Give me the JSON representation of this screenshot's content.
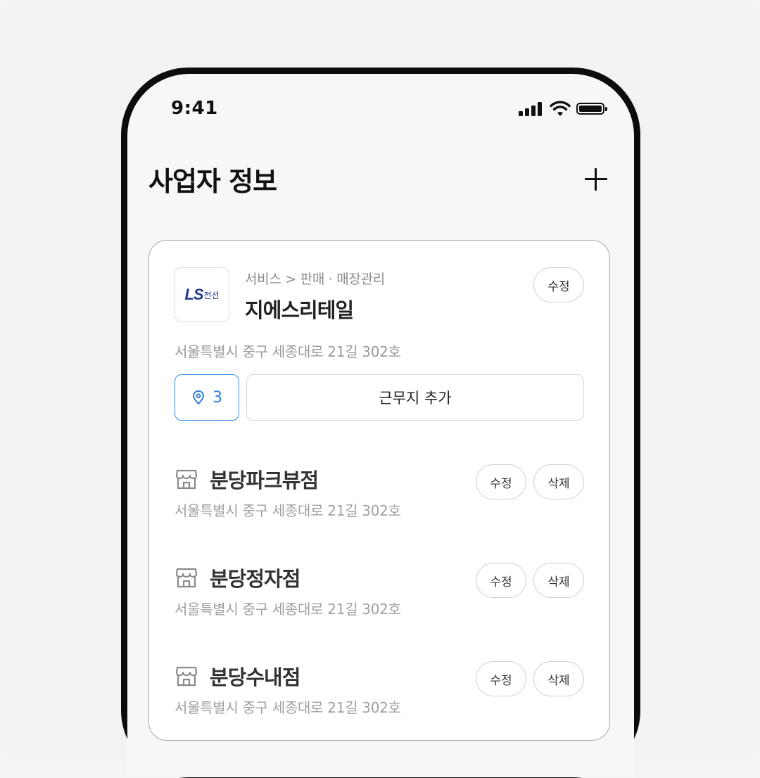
{
  "status_bar": {
    "time": "9:41"
  },
  "header": {
    "title": "사업자 정보"
  },
  "business": {
    "logo_text": "LS",
    "logo_subtext": "전선",
    "category": "서비스 > 판매 · 매장관리",
    "name": "지에스리테일",
    "address": "서울특별시 중구 세종대로 21길 302호",
    "edit_label": "수정",
    "location_count": "3",
    "add_site_label": "근무지 추가"
  },
  "stores": [
    {
      "name": "분당파크뷰점",
      "address": "서울특별시 중구 세종대로 21길 302호",
      "edit_label": "수정",
      "delete_label": "삭제"
    },
    {
      "name": "분당정자점",
      "address": "서울특별시 중구 세종대로 21길 302호",
      "edit_label": "수정",
      "delete_label": "삭제"
    },
    {
      "name": "분당수내점",
      "address": "서울특별시 중구 세종대로 21길 302호",
      "edit_label": "수정",
      "delete_label": "삭제"
    }
  ],
  "colors": {
    "accent": "#2f80d8",
    "text_primary": "#111111",
    "text_secondary": "#9a9a9a"
  },
  "icons": [
    "signal-icon",
    "wifi-icon",
    "battery-icon",
    "plus-icon",
    "location-pin-icon",
    "store-icon"
  ]
}
